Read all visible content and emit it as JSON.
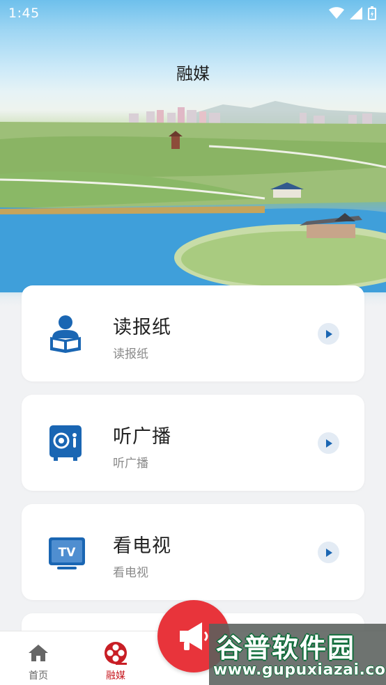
{
  "status_bar": {
    "time": "1:45"
  },
  "header": {
    "title": "融媒"
  },
  "cards": [
    {
      "title": "读报纸",
      "subtitle": "读报纸",
      "icon": "newspaper-reader-icon"
    },
    {
      "title": "听广播",
      "subtitle": "听广播",
      "icon": "radio-icon"
    },
    {
      "title": "看电视",
      "subtitle": "看电视",
      "icon": "tv-icon"
    }
  ],
  "tv_icon_text": "TV",
  "bottom_nav": {
    "items": [
      {
        "label": "首页",
        "icon": "home-icon",
        "active": false
      },
      {
        "label": "融媒",
        "icon": "media-reel-icon",
        "active": true
      }
    ]
  },
  "watermark": {
    "title": "谷普软件园",
    "url": "www.gupuxiazai.com"
  },
  "colors": {
    "accent_red": "#e8343b",
    "icon_blue": "#1a66b3",
    "active_nav": "#c81e25",
    "inactive_nav": "#666666",
    "arrow_bg": "#e3ebf4"
  }
}
